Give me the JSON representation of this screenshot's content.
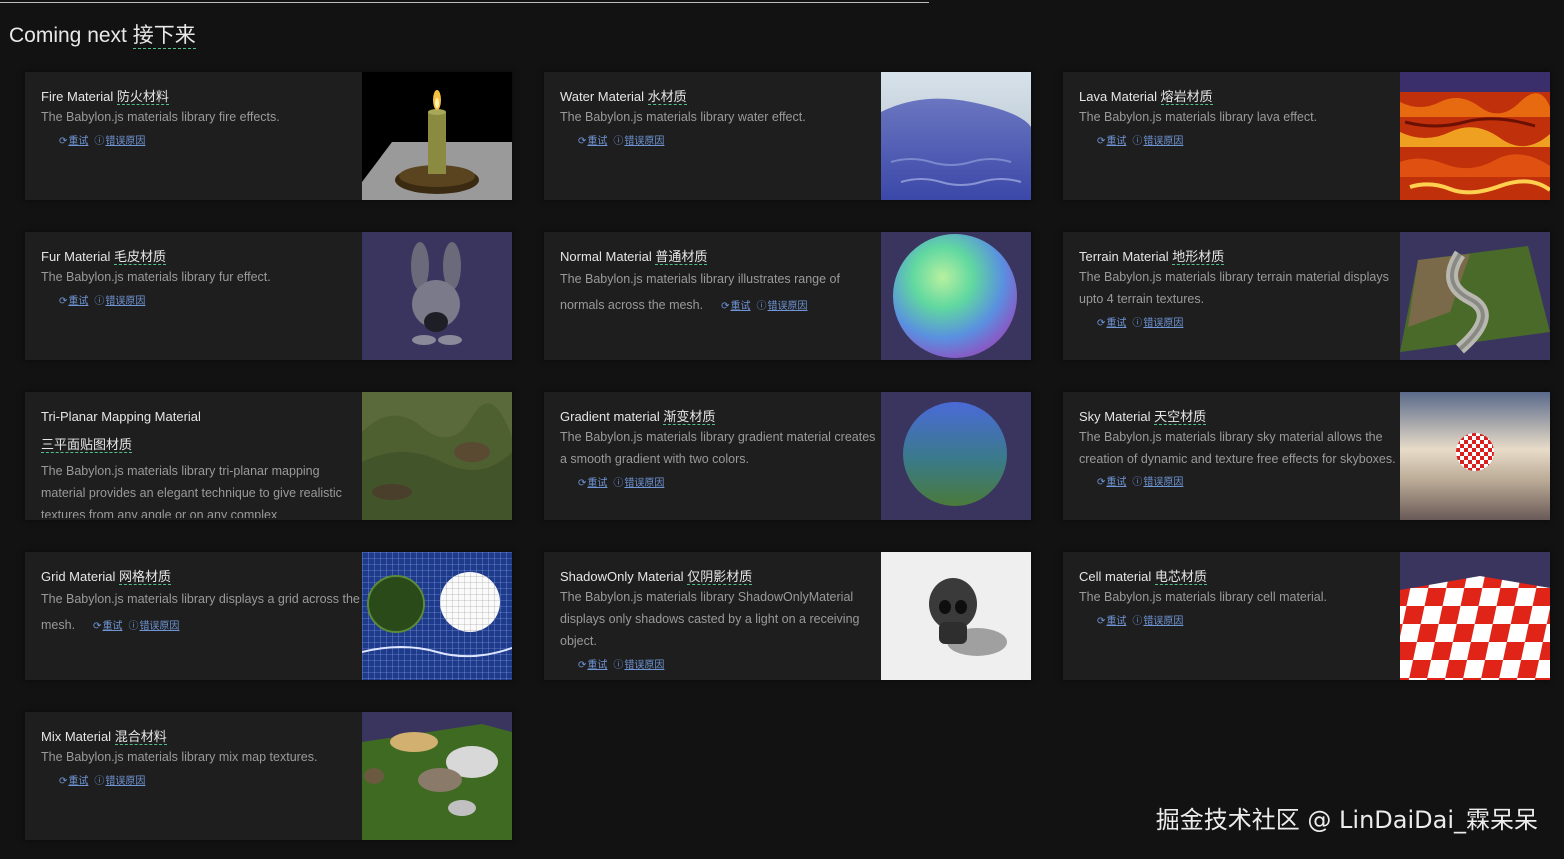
{
  "section": {
    "title_en": "Coming next",
    "title_zh": "接下来"
  },
  "actions": {
    "retry": "重试",
    "error": "错误原因"
  },
  "cards": [
    {
      "title_en": "Fire Material",
      "title_zh": "防火材料",
      "desc": "The Babylon.js materials library fire effects.",
      "thumbnail": "candle-fire-scene"
    },
    {
      "title_en": "Water Material",
      "title_zh": "水材质",
      "desc": "The Babylon.js materials library water effect.",
      "thumbnail": "water-scene"
    },
    {
      "title_en": "Lava Material",
      "title_zh": "熔岩材质",
      "desc": "The Babylon.js materials library lava effect.",
      "thumbnail": "lava-scene"
    },
    {
      "title_en": "Fur Material",
      "title_zh": "毛皮材质",
      "desc": "The Babylon.js materials library fur effect.",
      "thumbnail": "fur-rabbit-scene"
    },
    {
      "title_en": "Normal Material",
      "title_zh": "普通材质",
      "desc": "The Babylon.js materials library illustrates range of normals across the mesh.",
      "thumbnail": "normal-sphere-scene"
    },
    {
      "title_en": "Terrain Material",
      "title_zh": "地形材质",
      "desc": "The Babylon.js materials library terrain material displays upto 4 terrain textures.",
      "thumbnail": "terrain-scene"
    },
    {
      "title_en": "Tri-Planar Mapping Material",
      "title_zh": "三平面贴图材质",
      "desc": "The Babylon.js materials library tri-planar mapping material provides an elegant technique to give realistic textures from any angle or on any complex",
      "thumbnail": "triplanar-terrain-scene"
    },
    {
      "title_en": "Gradient material",
      "title_zh": "渐变材质",
      "desc": "The Babylon.js materials library gradient material creates a smooth gradient with two colors.",
      "thumbnail": "gradient-sphere-scene"
    },
    {
      "title_en": "Sky Material",
      "title_zh": "天空材质",
      "desc": "The Babylon.js materials library sky material allows the creation of dynamic and texture free effects for skyboxes.",
      "thumbnail": "sky-scene"
    },
    {
      "title_en": "Grid Material",
      "title_zh": "网格材质",
      "desc": "The Babylon.js materials library displays a grid across the mesh.",
      "thumbnail": "grid-scene"
    },
    {
      "title_en": "ShadowOnly Material",
      "title_zh": "仅阴影材质",
      "desc": "The Babylon.js materials library ShadowOnlyMaterial displays only shadows casted by a light on a receiving object.",
      "thumbnail": "skull-shadow-scene"
    },
    {
      "title_en": "Cell material",
      "title_zh": "电芯材质",
      "desc": "The Babylon.js materials library cell material.",
      "thumbnail": "cell-checker-scene"
    },
    {
      "title_en": "Mix Material",
      "title_zh": "混合材料",
      "desc": "The Babylon.js materials library mix map textures.",
      "thumbnail": "mix-terrain-scene"
    }
  ],
  "watermark": "掘金技术社区 @ LinDaiDai_霖呆呆",
  "colors": {
    "background": "#121212",
    "card": "#1e1e1e",
    "link": "#6f95d6",
    "dashed_underline": "#4fc08d"
  }
}
